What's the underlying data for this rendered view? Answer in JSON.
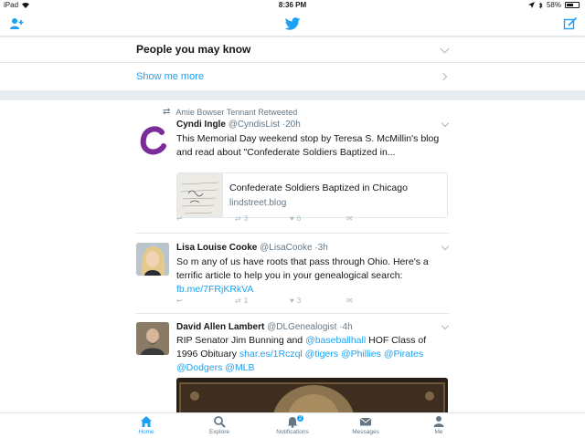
{
  "status_bar": {
    "device": "iPad",
    "time": "8:36 PM",
    "battery": "58%",
    "battery_level": 0.58
  },
  "nav": {
    "add_user_icon": "add-user-icon",
    "logo_icon": "twitter-bird-icon",
    "compose_icon": "compose-icon",
    "accent": "#1da1f2"
  },
  "pymk": {
    "title": "People you may know",
    "show_more": "Show me more"
  },
  "tweets": [
    {
      "retweeted_by": "Amie Bowser Tennant Retweeted",
      "name": "Cyndi Ingle",
      "handle": "@CyndisList",
      "time": "20h",
      "text": "This Memorial Day weekend stop by Teresa S. McMillin's blog and read about \"Confederate Soldiers Baptized in...",
      "card": {
        "title": "Confederate Soldiers Baptized in Chicago",
        "domain": "lindstreet.blog"
      },
      "retweets": "3",
      "likes": "6"
    },
    {
      "name": "Lisa Louise Cooke",
      "handle": "@LisaCooke",
      "time": "3h",
      "text": "So m any of us have roots that pass through Ohio. Here's a terrific article to help you in your genealogical search:",
      "link": "fb.me/7FRjKRkVA",
      "retweets": "1",
      "likes": "3"
    },
    {
      "name": "David Allen Lambert",
      "handle": "@DLGenealogist",
      "time": "4h",
      "text_plain_1": "RIP Senator Jim Bunning and ",
      "mention_1": "@baseballhall",
      "text_plain_2": " HOF Class of 1996 Obituary ",
      "link": "shar.es/1Rczql",
      "mention_2": "@tigers",
      "mention_3": "@Phillies",
      "mention_4": "@Pirates",
      "mention_5": "@Dodgers",
      "mention_6": "@MLB"
    }
  ],
  "tabs": [
    {
      "label": "Home",
      "icon": "home-icon",
      "active": true
    },
    {
      "label": "Explore",
      "icon": "search-icon",
      "active": false
    },
    {
      "label": "Notifications",
      "icon": "bell-icon",
      "badge": "2",
      "active": false
    },
    {
      "label": "Messages",
      "icon": "envelope-icon",
      "active": false
    },
    {
      "label": "Me",
      "icon": "person-icon",
      "active": false
    }
  ]
}
